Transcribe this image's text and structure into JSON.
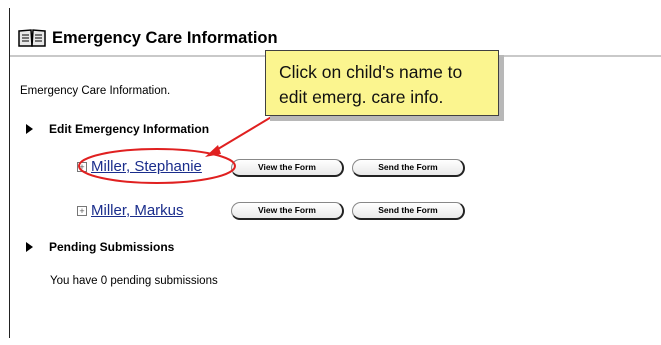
{
  "header": {
    "title": "Emergency Care Information",
    "icon": "book-icon"
  },
  "intro_text": "Emergency Care Information.",
  "callout": {
    "line1": "Click on child's name to",
    "line2": "edit emerg. care info."
  },
  "sections": {
    "edit": {
      "title": "Edit Emergency Information"
    },
    "pending": {
      "title": "Pending Submissions",
      "message": "You have 0 pending submissions"
    }
  },
  "children": [
    {
      "name": "Miller, Stephanie",
      "view_label": "View the Form",
      "send_label": "Send the Form"
    },
    {
      "name": "Miller, Markus",
      "view_label": "View the Form",
      "send_label": "Send the Form"
    }
  ],
  "colors": {
    "callout_bg": "#fbf58f",
    "highlight": "#e02020",
    "link": "#1a2d8c",
    "rule": "#c9c9c9"
  }
}
